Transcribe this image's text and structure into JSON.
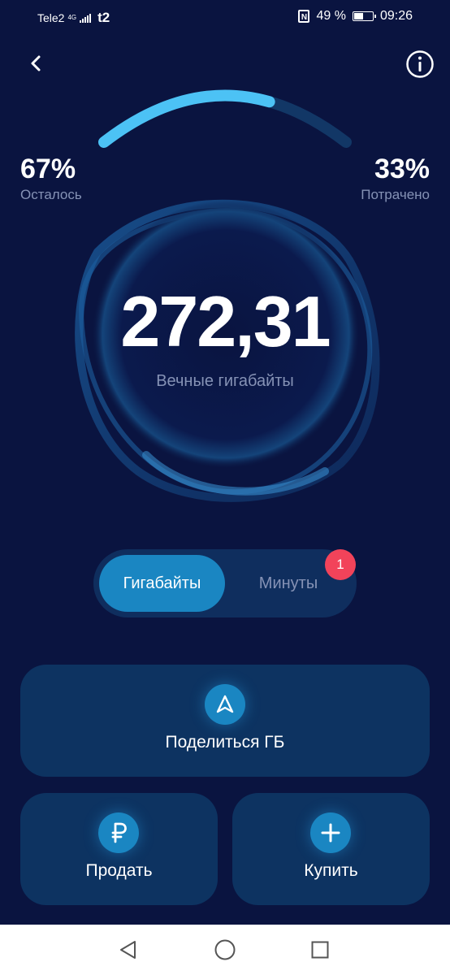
{
  "status_bar": {
    "carrier": "Tele2",
    "network": "4G",
    "operator_logo": "t2",
    "nfc": "N",
    "battery": "49 %",
    "battery_level": 0.49,
    "time": "09:26"
  },
  "header": {
    "back_icon": "chevron-left-icon",
    "info_icon": "info-circle-icon"
  },
  "gauge": {
    "remaining_percent": "67%",
    "remaining_label": "Осталось",
    "spent_percent": "33%",
    "spent_label": "Потрачено",
    "fill_fraction": 0.67
  },
  "balance": {
    "value": "272,31",
    "label": "Вечные гигабайты"
  },
  "tabs": {
    "items": [
      {
        "label": "Гигабайты",
        "active": true
      },
      {
        "label": "Минуты",
        "active": false
      }
    ],
    "badge": "1"
  },
  "actions": {
    "share_label": "Поделиться ГБ",
    "share_icon": "send-arrow-icon",
    "sell_label": "Продать",
    "sell_icon": "ruble-icon",
    "buy_label": "Купить",
    "buy_icon": "plus-icon"
  },
  "nav": {
    "back": "triangle-back-icon",
    "home": "circle-home-icon",
    "recents": "square-recents-icon"
  },
  "colors": {
    "background": "#0a1440",
    "accent": "#1a86c2",
    "gauge_fill": "#4cc2f5",
    "card": "#0d3361",
    "badge": "#f2435a"
  }
}
